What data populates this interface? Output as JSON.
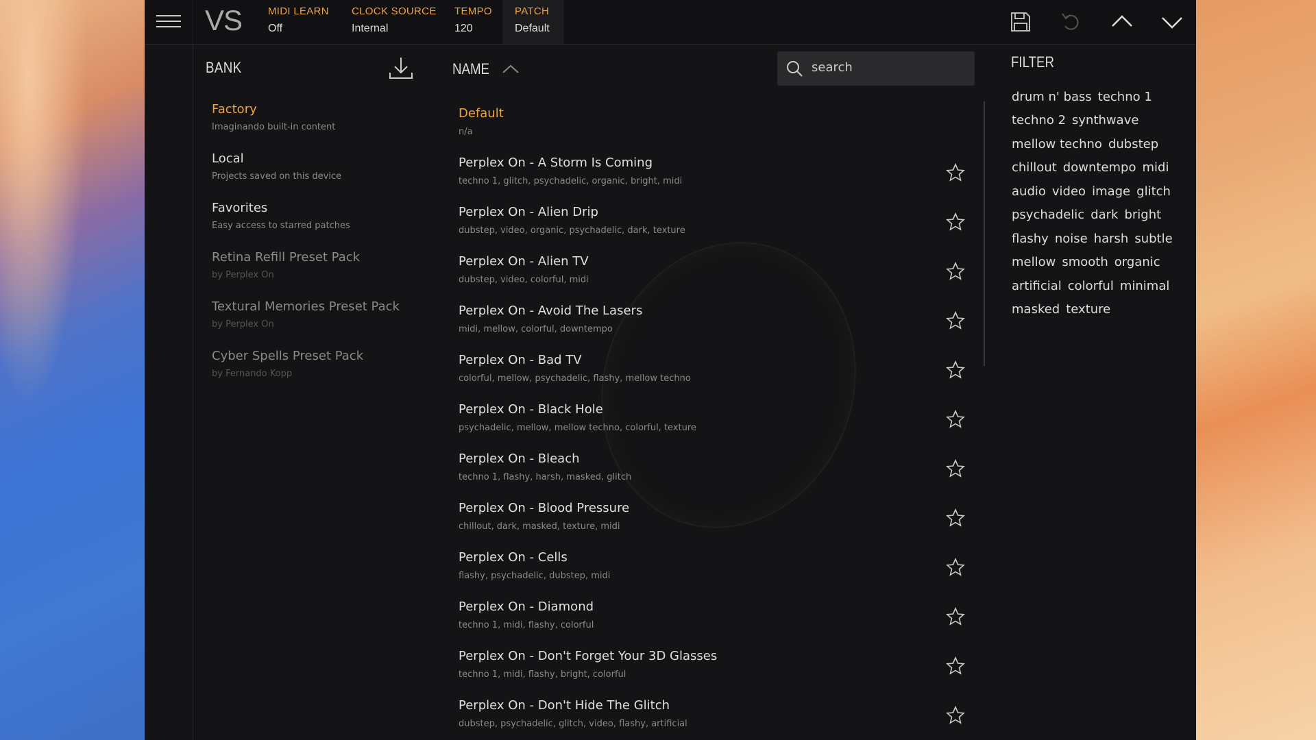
{
  "header": {
    "logo": "VS",
    "midi_learn": {
      "label": "MIDI LEARN",
      "value": "Off"
    },
    "clock_source": {
      "label": "CLOCK SOURCE",
      "value": "Internal"
    },
    "tempo": {
      "label": "TEMPO",
      "value": "120"
    },
    "patch": {
      "label": "PATCH",
      "value": "Default"
    }
  },
  "bank": {
    "title": "BANK",
    "items": [
      {
        "name": "Factory",
        "desc": "Imaginando built-in content"
      },
      {
        "name": "Local",
        "desc": "Projects saved on this device"
      },
      {
        "name": "Favorites",
        "desc": "Easy access to starred patches"
      },
      {
        "name": "Retina Refill Preset Pack",
        "desc": "by Perplex On"
      },
      {
        "name": "Textural Memories Preset Pack",
        "desc": "by Perplex On"
      },
      {
        "name": "Cyber Spells Preset Pack",
        "desc": "by Fernando Kopp"
      }
    ]
  },
  "list": {
    "title": "NAME",
    "search_placeholder": "search",
    "rows": [
      {
        "title": "Default",
        "tags": "n/a"
      },
      {
        "title": "Perplex On - A Storm Is Coming",
        "tags": "techno 1, glitch, psychadelic, organic, bright, midi"
      },
      {
        "title": "Perplex On - Alien Drip",
        "tags": "dubstep, video, organic, psychadelic, dark, texture"
      },
      {
        "title": "Perplex On - Alien TV",
        "tags": "dubstep, video, colorful, midi"
      },
      {
        "title": "Perplex On - Avoid The Lasers",
        "tags": "midi, mellow, colorful, downtempo"
      },
      {
        "title": "Perplex On - Bad TV",
        "tags": "colorful, mellow, psychadelic, flashy, mellow techno"
      },
      {
        "title": "Perplex On - Black Hole",
        "tags": "psychadelic, mellow, mellow techno, colorful, texture"
      },
      {
        "title": "Perplex On - Bleach",
        "tags": "techno 1, flashy, harsh, masked, glitch"
      },
      {
        "title": "Perplex On - Blood Pressure",
        "tags": "chillout, dark, masked, texture, midi"
      },
      {
        "title": "Perplex On - Cells",
        "tags": "flashy, psychadelic, dubstep, midi"
      },
      {
        "title": "Perplex On - Diamond",
        "tags": "techno 1, midi, flashy, colorful"
      },
      {
        "title": "Perplex On - Don't Forget Your 3D Glasses",
        "tags": "techno 1, midi, flashy, bright, colorful"
      },
      {
        "title": "Perplex On - Don't Hide The Glitch",
        "tags": "dubstep, psychadelic, glitch, video, flashy, artificial"
      }
    ]
  },
  "filter": {
    "title": "FILTER",
    "lines": [
      [
        "drum n' bass",
        "techno 1"
      ],
      [
        "techno 2",
        "synthwave"
      ],
      [
        "mellow techno",
        "dubstep"
      ],
      [
        "chillout",
        "downtempo",
        "midi"
      ],
      [
        "audio",
        "video",
        "image",
        "glitch"
      ],
      [
        "psychadelic",
        "dark",
        "bright"
      ],
      [
        "flashy",
        "noise",
        "harsh",
        "subtle"
      ],
      [
        "mellow",
        "smooth",
        "organic"
      ],
      [
        "artificial",
        "colorful",
        "minimal"
      ],
      [
        "masked",
        "texture"
      ]
    ]
  },
  "colors": {
    "accent": "#f0a23c",
    "background": "#141416"
  }
}
